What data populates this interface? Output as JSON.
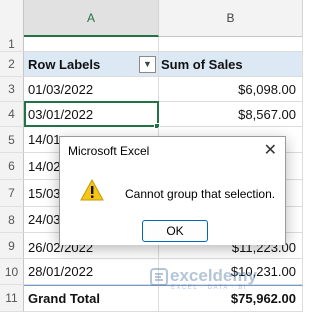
{
  "columns": [
    "A",
    "B"
  ],
  "rows": [
    {
      "num": "1",
      "a": "",
      "b": ""
    },
    {
      "num": "2",
      "a": "Row Labels",
      "b": "Sum of Sales"
    },
    {
      "num": "3",
      "a": "01/03/2022",
      "b": "$6,098.00"
    },
    {
      "num": "4",
      "a": "03/01/2022",
      "b": "$8,567.00"
    },
    {
      "num": "5",
      "a": "14/01",
      "b": ""
    },
    {
      "num": "6",
      "a": "14/02",
      "b": ""
    },
    {
      "num": "7",
      "a": "15/03",
      "b": ""
    },
    {
      "num": "8",
      "a": "24/03",
      "b": ""
    },
    {
      "num": "9",
      "a": "26/02/2022",
      "b": "$11,223.00"
    },
    {
      "num": "10",
      "a": "28/01/2022",
      "b": "$10,231.00"
    },
    {
      "num": "11",
      "a": "Grand Total",
      "b": "$75,962.00"
    }
  ],
  "dialog": {
    "title": "Microsoft Excel",
    "close_glyph": "✕",
    "message": "Cannot group that selection.",
    "ok_label": "OK"
  },
  "watermark": {
    "name": "exceldemy",
    "tagline": "EXCEL · DATA · BI"
  },
  "colors": {
    "accent": "#217346",
    "header_fill": "#dde8f5",
    "warning": "#f5c518"
  }
}
